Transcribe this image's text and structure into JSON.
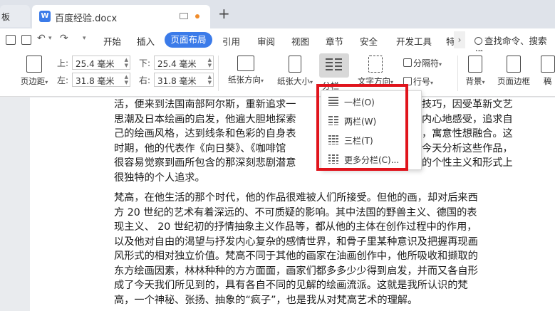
{
  "titlebar": {
    "prev_tab_label": "板",
    "doc_tab_title": "百度经验.docx",
    "doc_icon_letter": "W",
    "new_tab": "+"
  },
  "menubar": {
    "items": [
      "开始",
      "插入",
      "页面布局",
      "引用",
      "审阅",
      "视图",
      "章节",
      "安全",
      "开发工具",
      "特"
    ],
    "active": "页面布局",
    "more": "›",
    "search_placeholder": "查找命令、搜索模"
  },
  "ribbon": {
    "margins_label": "页边距",
    "top_label": "上:",
    "top_value": "25.4 毫米",
    "bottom_label": "下:",
    "bottom_value": "25.4 毫米",
    "left_label": "左:",
    "left_value": "31.8 毫米",
    "right_label": "右:",
    "right_value": "31.8 毫米",
    "orientation_label": "纸张方向",
    "size_label": "纸张大小",
    "columns_label": "分栏",
    "text_direction_label": "文字方向",
    "separator_label": "分隔符",
    "line_number_label": "行号",
    "background_label": "背景",
    "page_border_label": "页面边框",
    "draft_label": "稿"
  },
  "columns_menu": {
    "items": [
      {
        "label": "一栏(O)",
        "icon": "one-column-icon"
      },
      {
        "label": "两栏(W)",
        "icon": "two-column-icon"
      },
      {
        "label": "三栏(T)",
        "icon": "three-column-icon"
      },
      {
        "label": "更多分栏(C)...",
        "icon": "more-columns-icon"
      }
    ]
  },
  "document": {
    "paragraph1": [
      "活，便来到法国南部阿尔斯，重新追求一",
      "思潮及日本绘画的启发，他遍大胆地探索",
      "己的绘画风格，达到线条和色彩的自身表",
      "时期，他的代表作《向日葵》、《咖啡馆",
      "很容易觉察到画所包含的那深刻悲剧潜意",
      "很独特的个人追求。"
    ],
    "paragraph1_tail": [
      "技巧，因受革新文艺",
      "内心地感受，追求自",
      "，寓意性想融合。这",
      "今天分析这些作品，",
      "的个性主义和形式上",
      ""
    ],
    "paragraph2": [
      "梵高，在他生活的那个时代，他的作品很难被人们所接受。但他的画，却对后来西",
      "方 20 世纪的艺术有着深远的、不可质疑的影响。其中法国的野兽主义、德国的表",
      "现主义、 20 世纪初的抒情抽象主义作品等，都从他的主体在创作过程中的作用，",
      "以及他对自由的渴望与抒发内心复杂的感情世界，和骨子里某种意识及把握再现画",
      "风形式的相对独立价值。梵高不同于其他的画家在油画创作中，他所吸收和撷取的",
      "东方绘画因素，林林种种的方方面面，画家们都多多少少得到启发，并而又各自形",
      "成了今天我们所见到的，具有各自不同的见解的绘画流派。这就是我所认识的梵",
      "高，一个神秘、张扬、抽象的“疯子”，也是我从对梵高艺术的理解。"
    ]
  },
  "colors": {
    "accent": "#3b7be9",
    "highlight": "#e0141c"
  }
}
